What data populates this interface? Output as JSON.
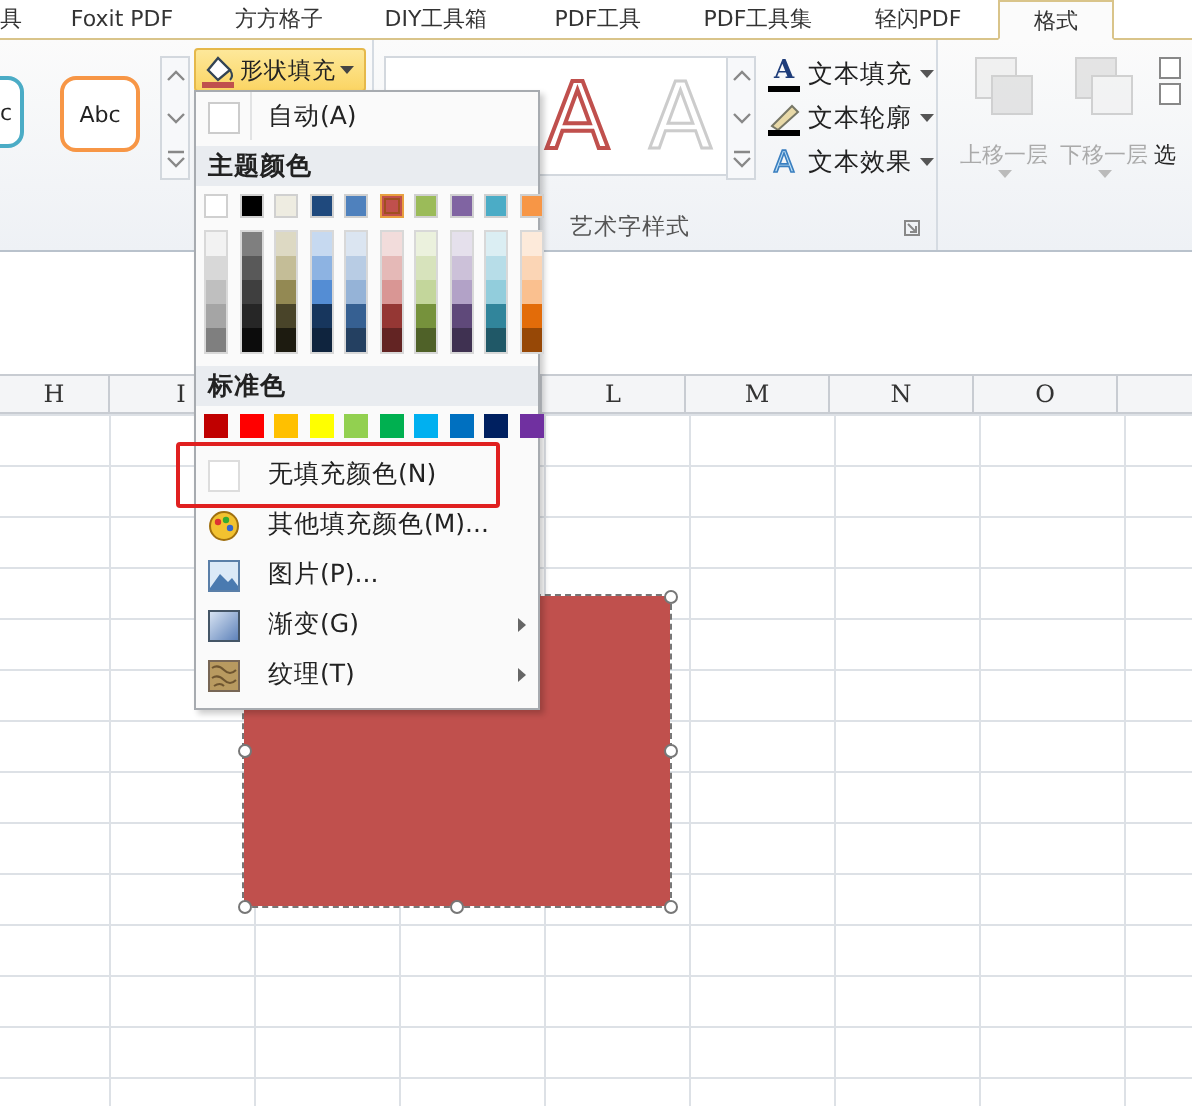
{
  "tabs": [
    {
      "label": "具",
      "selected": false
    },
    {
      "label": "Foxit PDF",
      "selected": false
    },
    {
      "label": "方方格子",
      "selected": false
    },
    {
      "label": "DIY工具箱",
      "selected": false
    },
    {
      "label": "PDF工具",
      "selected": false
    },
    {
      "label": "PDF工具集",
      "selected": false
    },
    {
      "label": "轻闪PDF",
      "selected": false
    },
    {
      "label": "格式",
      "selected": true
    }
  ],
  "shape_styles": {
    "samples": [
      "c",
      "Abc"
    ]
  },
  "fill_button": {
    "label": "形状填充",
    "open": true
  },
  "wordart_group": {
    "samples": [
      "A",
      "A"
    ],
    "commands": [
      {
        "kind": "fill",
        "icon": "A",
        "label": "文本填充"
      },
      {
        "kind": "outline",
        "label": "文本轮廓"
      },
      {
        "kind": "effect",
        "icon": "A",
        "label": "文本效果"
      }
    ],
    "title": "艺术字样式"
  },
  "arrange_group": {
    "commands": [
      {
        "kind": "forward",
        "label": "上移一层",
        "disabled": true
      },
      {
        "kind": "backward",
        "label": "下移一层",
        "disabled": true
      },
      {
        "kind": "select",
        "label": "选",
        "disabled": false
      }
    ]
  },
  "sheet": {
    "columns": [
      {
        "label": "H"
      },
      {
        "label": "I"
      },
      {},
      {},
      {
        "label": "L"
      },
      {
        "label": "M"
      },
      {
        "label": "N"
      },
      {
        "label": "O"
      },
      {}
    ],
    "shape": {
      "selected": true
    }
  },
  "fill_menu": {
    "auto": {
      "label": "自动(A)"
    },
    "theme_title": "主题颜色",
    "theme_colors": [
      {
        "color": "#ffffff",
        "selected": false,
        "shades": [
          {
            "color": "#f2f2f2",
            "selected": false
          },
          {
            "color": "#d8d8d8",
            "selected": false
          },
          {
            "color": "#bfbfbf",
            "selected": false
          },
          {
            "color": "#a5a5a5",
            "selected": false
          },
          {
            "color": "#7f7f7f",
            "selected": false
          }
        ]
      },
      {
        "color": "#000000",
        "selected": false,
        "shades": [
          {
            "color": "#7f7f7f",
            "selected": false
          },
          {
            "color": "#595959",
            "selected": false
          },
          {
            "color": "#3f3f3f",
            "selected": false
          },
          {
            "color": "#262626",
            "selected": false
          },
          {
            "color": "#0c0c0c",
            "selected": false
          }
        ]
      },
      {
        "color": "#eeece1",
        "selected": false,
        "shades": [
          {
            "color": "#ddd9c3",
            "selected": false
          },
          {
            "color": "#c4bd97",
            "selected": false
          },
          {
            "color": "#938953",
            "selected": false
          },
          {
            "color": "#494429",
            "selected": false
          },
          {
            "color": "#1d1b10",
            "selected": false
          }
        ]
      },
      {
        "color": "#1f497d",
        "selected": false,
        "shades": [
          {
            "color": "#c6d9f0",
            "selected": false
          },
          {
            "color": "#8db3e2",
            "selected": false
          },
          {
            "color": "#548dd4",
            "selected": false
          },
          {
            "color": "#17365d",
            "selected": false
          },
          {
            "color": "#0f243e",
            "selected": false
          }
        ]
      },
      {
        "color": "#4f81bd",
        "selected": false,
        "shades": [
          {
            "color": "#dbe5f1",
            "selected": false
          },
          {
            "color": "#b8cce4",
            "selected": false
          },
          {
            "color": "#95b3d7",
            "selected": false
          },
          {
            "color": "#366092",
            "selected": false
          },
          {
            "color": "#244061",
            "selected": false
          }
        ]
      },
      {
        "color": "#c0504d",
        "selected": true,
        "shades": [
          {
            "color": "#f2dcdb",
            "selected": false
          },
          {
            "color": "#e5b9b7",
            "selected": false
          },
          {
            "color": "#d99694",
            "selected": false
          },
          {
            "color": "#953734",
            "selected": false
          },
          {
            "color": "#632423",
            "selected": false
          }
        ]
      },
      {
        "color": "#9bbb59",
        "selected": false,
        "shades": [
          {
            "color": "#ebf1dd",
            "selected": false
          },
          {
            "color": "#d7e3bc",
            "selected": false
          },
          {
            "color": "#c3d69b",
            "selected": false
          },
          {
            "color": "#76923c",
            "selected": false
          },
          {
            "color": "#4f6128",
            "selected": false
          }
        ]
      },
      {
        "color": "#8064a2",
        "selected": false,
        "shades": [
          {
            "color": "#e5e0ec",
            "selected": false
          },
          {
            "color": "#ccc1d9",
            "selected": false
          },
          {
            "color": "#b2a2c7",
            "selected": false
          },
          {
            "color": "#5f497a",
            "selected": false
          },
          {
            "color": "#3f3151",
            "selected": false
          }
        ]
      },
      {
        "color": "#4bacc6",
        "selected": false,
        "shades": [
          {
            "color": "#dbeef3",
            "selected": false
          },
          {
            "color": "#b7dde8",
            "selected": false
          },
          {
            "color": "#92cddc",
            "selected": false
          },
          {
            "color": "#31859b",
            "selected": false
          },
          {
            "color": "#205867",
            "selected": false
          }
        ]
      },
      {
        "color": "#f79646",
        "selected": false,
        "shades": [
          {
            "color": "#fdeada",
            "selected": false
          },
          {
            "color": "#fbd5b5",
            "selected": false
          },
          {
            "color": "#fac08f",
            "selected": false
          },
          {
            "color": "#e36c09",
            "selected": false
          },
          {
            "color": "#974806",
            "selected": false
          }
        ]
      }
    ],
    "standard_title": "标准色",
    "standard_colors": [
      {
        "color": "#c00000",
        "selected": false
      },
      {
        "color": "#ff0000",
        "selected": false
      },
      {
        "color": "#ffc000",
        "selected": false
      },
      {
        "color": "#ffff00",
        "selected": false
      },
      {
        "color": "#92d050",
        "selected": false
      },
      {
        "color": "#00b050",
        "selected": false
      },
      {
        "color": "#00b0f0",
        "selected": false
      },
      {
        "color": "#0070c0",
        "selected": false
      },
      {
        "color": "#002060",
        "selected": false
      },
      {
        "color": "#7030a0",
        "selected": false
      }
    ],
    "items": [
      {
        "kind": "no_fill",
        "label": "无填充颜色(N)",
        "has_submenu": false,
        "highlighted": true
      },
      {
        "kind": "more_colors",
        "label": "其他填充颜色(M)...",
        "has_submenu": false,
        "highlighted": false
      },
      {
        "kind": "picture",
        "label": "图片(P)...",
        "has_submenu": false,
        "highlighted": false
      },
      {
        "kind": "gradient",
        "label": "渐变(G)",
        "has_submenu": true,
        "highlighted": false
      },
      {
        "kind": "texture",
        "label": "纹理(T)",
        "has_submenu": true,
        "highlighted": false
      }
    ]
  }
}
